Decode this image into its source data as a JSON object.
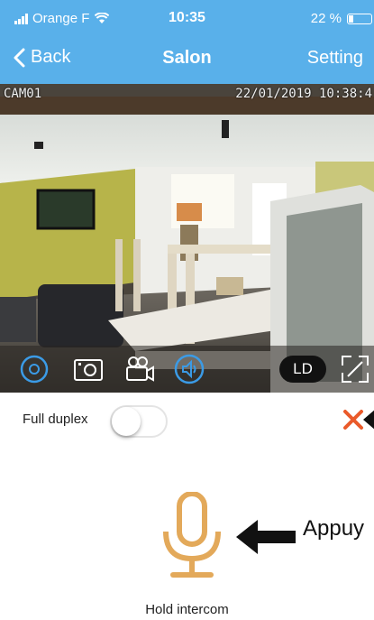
{
  "status_bar": {
    "carrier": "Orange F",
    "time": "10:35",
    "battery": "22 %",
    "battery_level": 0.22
  },
  "nav": {
    "back_label": "Back",
    "title": "Salon",
    "setting_label": "Setting"
  },
  "video": {
    "camera_name": "CAM01",
    "timestamp": "22/01/2019 10:38:4"
  },
  "controls": {
    "quality_label": "LD",
    "icons": [
      "settings-circle-icon",
      "snapshot-icon",
      "record-video-icon",
      "audio-icon",
      "fullscreen-icon"
    ]
  },
  "duplex": {
    "label": "Full duplex",
    "enabled": false
  },
  "intercom": {
    "hint_text": "Appuy",
    "label": "Hold intercom",
    "accent_color": "#e3a95a"
  },
  "colors": {
    "header": "#59b0ea",
    "close": "#ea5a2a",
    "control_icon_active": "#3b9be6"
  }
}
